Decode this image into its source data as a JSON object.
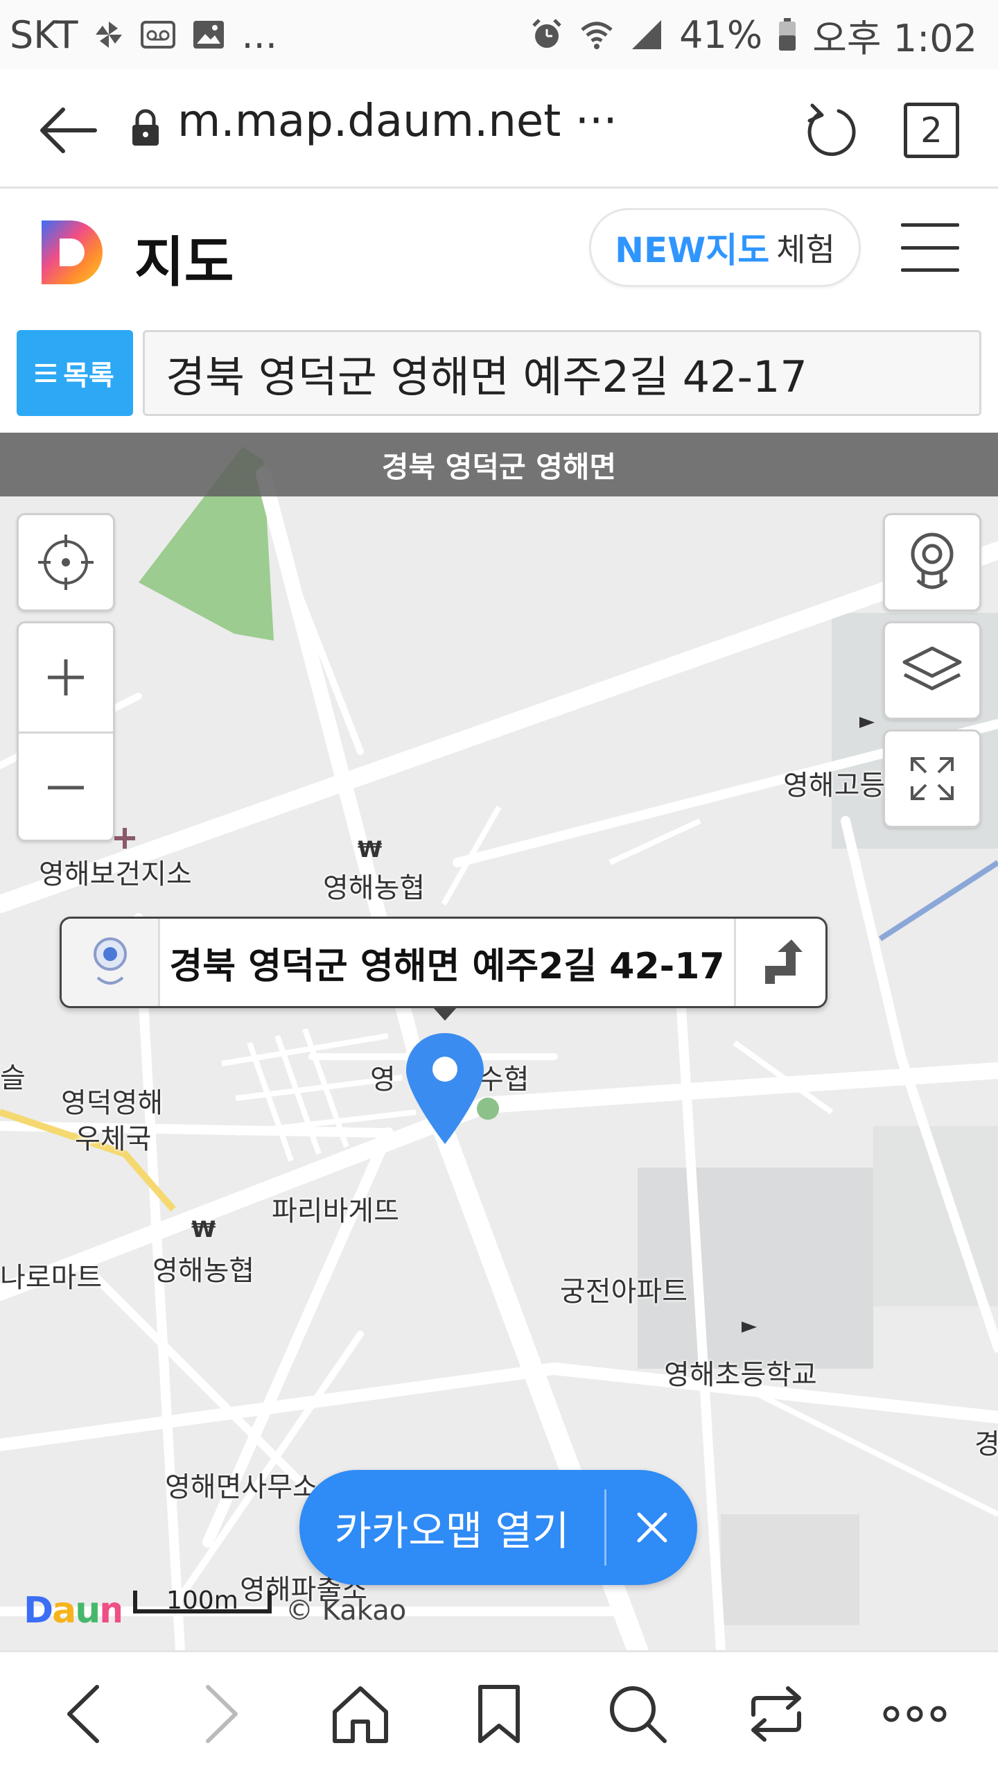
{
  "status_bar": {
    "carrier": "SKT",
    "more": "...",
    "battery": "41%",
    "time": "오후 1:02"
  },
  "browser": {
    "url": "m.map.daum.net",
    "url_more": "···",
    "tab_count": "2"
  },
  "header": {
    "title": "지도",
    "new_map_label_strong": "NEW지도",
    "new_map_label": "체험"
  },
  "search": {
    "list_button": "목록",
    "query": "경북 영덕군 영해면 예주2길 42-17"
  },
  "map": {
    "region": "경북 영덕군 영해면",
    "popup_address": "경북 영덕군 영해면 예주2길 42-17",
    "pois": {
      "health_center": "영해보건지소",
      "nonghyup1": "영해농협",
      "nonghyup2": "영해농협",
      "suhyup": "수협",
      "suhyup_prefix": "영",
      "post_office_1": "영덕영해",
      "post_office_2": "우체국",
      "paris": "파리바게뜨",
      "naro": "나로마트",
      "apartment": "궁전아파트",
      "elementary": "영해초등학교",
      "high_school": "영해고등",
      "myeon_office": "영해면사무소",
      "police": "영해파출소",
      "left_edge": "슬",
      "right_edge": "경"
    },
    "scale_label": "100m",
    "copyright": "© Kakao",
    "open_app_label": "카카오맵 열기"
  },
  "colors": {
    "accent_blue": "#2f8bf5",
    "list_button": "#2da8f5",
    "marker": "#3b8cf0",
    "park_green": "#9ccc8f"
  },
  "icons": {
    "back": "arrow-left-icon",
    "lock": "lock-icon",
    "reload": "reload-icon",
    "menu": "hamburger-icon",
    "locate": "crosshair-icon",
    "roadview": "roadview-camera-icon",
    "layers": "layers-icon",
    "fullscreen": "fullscreen-icon",
    "route": "route-arrow-icon",
    "marker": "map-pin-icon"
  }
}
